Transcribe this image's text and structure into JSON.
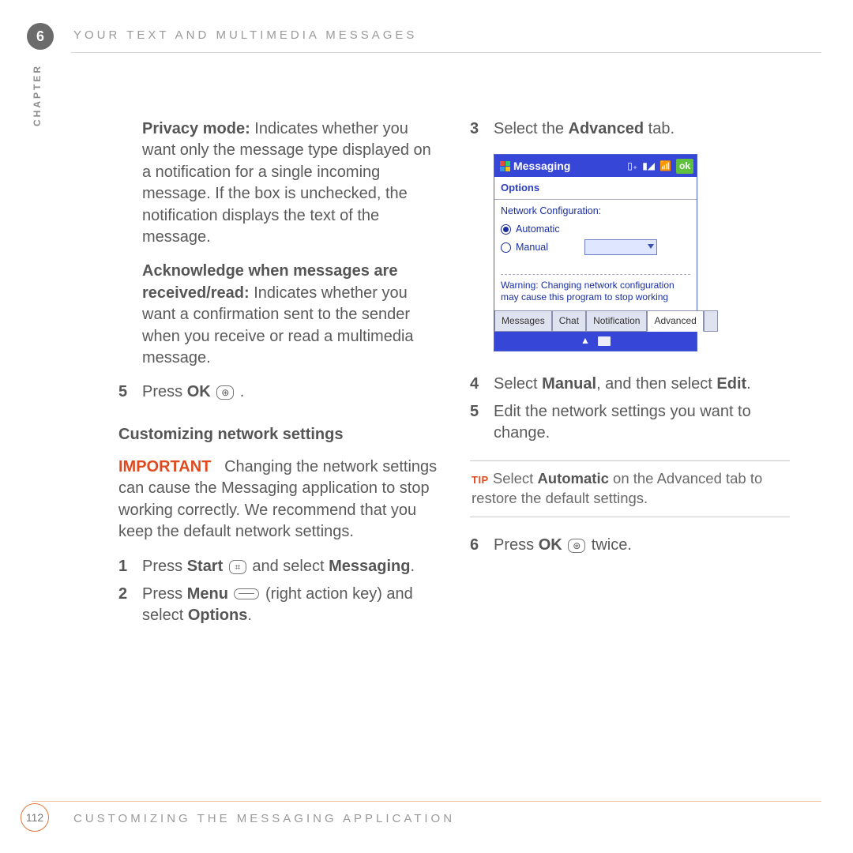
{
  "chapter_number": "6",
  "running_head": "YOUR TEXT AND MULTIMEDIA MESSAGES",
  "side_label": "CHAPTER",
  "page_number": "112",
  "footer": "CUSTOMIZING THE MESSAGING APPLICATION",
  "left": {
    "para1": {
      "lead": "Privacy mode:",
      "rest": " Indicates whether you want only the message type displayed on a notification for a single incoming message. If the box is unchecked, the notification displays the text of the message."
    },
    "para2": {
      "lead": "Acknowledge when messages are received/read:",
      "rest": " Indicates whether you want a confirmation sent to the sender when you receive or read a multimedia message."
    },
    "step5": {
      "num": "5",
      "pre": "Press ",
      "b1": "OK",
      "post": " ."
    },
    "subhead": "Customizing network settings",
    "important": {
      "label": "IMPORTANT",
      "body": " Changing the network settings can cause the Messaging application to stop working correctly. We recommend that you keep the default network settings."
    },
    "step1": {
      "num": "1",
      "pre": "Press ",
      "b1": "Start",
      "mid": " and select ",
      "b2": "Messaging",
      "post": "."
    },
    "step2": {
      "num": "2",
      "pre": "Press ",
      "b1": "Menu",
      "mid1": " (right action key) and select ",
      "b2": "Options",
      "post": "."
    }
  },
  "right": {
    "step3": {
      "num": "3",
      "pre": "Select the ",
      "b1": "Advanced",
      "post": " tab."
    },
    "step4": {
      "num": "4",
      "pre": "Select ",
      "b1": "Manual",
      "mid": ", and then select ",
      "b2": "Edit",
      "post": "."
    },
    "step5b": {
      "num": "5",
      "body": "Edit the network settings you want to change."
    },
    "tip": {
      "label": "TIP",
      "pre": " Select ",
      "b1": "Automatic",
      "post": " on the Advanced tab to restore the default settings."
    },
    "step6": {
      "num": "6",
      "pre": "Press ",
      "b1": "OK",
      "post": " twice."
    }
  },
  "screenshot": {
    "app_title": "Messaging",
    "ok": "ok",
    "panel_title": "Options",
    "nc_label": "Network Configuration:",
    "opt_auto": "Automatic",
    "opt_manual": "Manual",
    "warning": "Warning: Changing network configuration may cause this program to stop working",
    "tabs": [
      "Messages",
      "Chat",
      "Notification",
      "Advanced"
    ]
  },
  "icons": {
    "ok": "⊛",
    "start": "⌗"
  }
}
